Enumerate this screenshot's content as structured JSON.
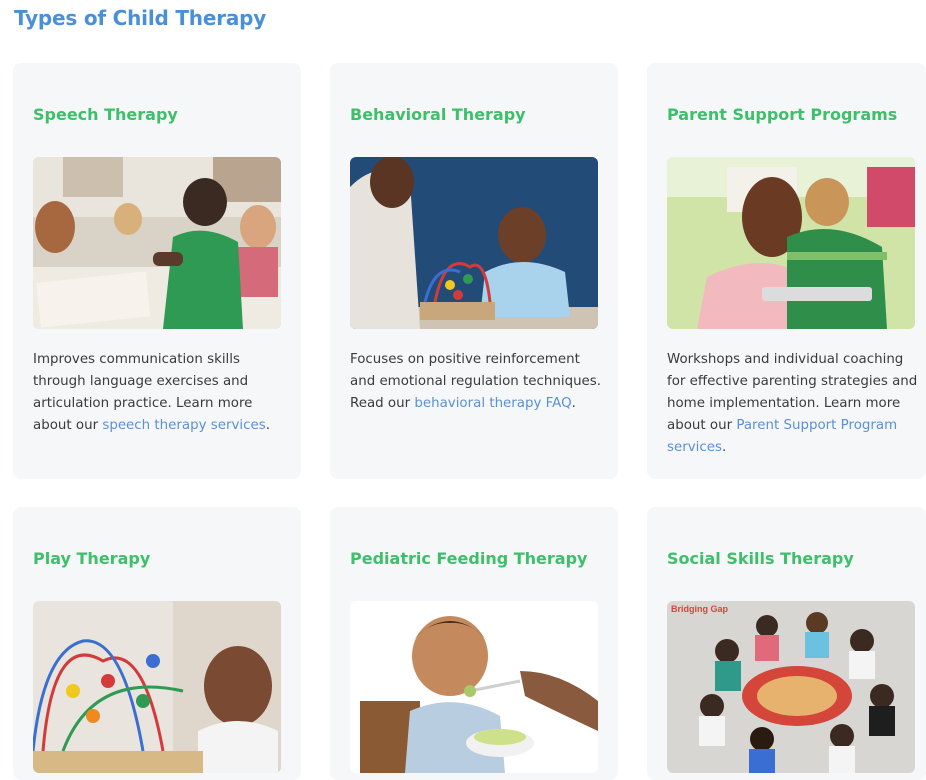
{
  "page": {
    "title": "Types of Child Therapy"
  },
  "cards": [
    {
      "title": "Speech Therapy",
      "image": "children-writing-classroom-photo",
      "desc_before": "Improves communication skills through language exercises and articulation practice. Learn more about our ",
      "link": "speech therapy services",
      "desc_after": "."
    },
    {
      "title": "Behavioral Therapy",
      "image": "boy-laughing-bead-maze-photo",
      "desc_before": "Focuses on positive reinforcement and emotional regulation techniques. Read our ",
      "link": "behavioral therapy FAQ",
      "desc_after": "."
    },
    {
      "title": "Parent Support Programs",
      "image": "mother-son-tablet-photo",
      "desc_before": "Workshops and individual coaching for effective parenting strategies and home implementation. Learn more about our ",
      "link": "Parent Support Program services",
      "desc_after": "."
    },
    {
      "title": "Play Therapy",
      "image": "girl-bead-maze-toy-photo"
    },
    {
      "title": "Pediatric Feeding Therapy",
      "image": "toddler-eating-spoon-photo"
    },
    {
      "title": "Social Skills Therapy",
      "image": "children-circle-playing-photo",
      "image_text": "Bridging Gap"
    }
  ],
  "colors": {
    "heading": "#4a90d9",
    "card_title": "#3ebf6a",
    "link": "#5b8fd6",
    "card_bg": "#f6f7f9"
  }
}
